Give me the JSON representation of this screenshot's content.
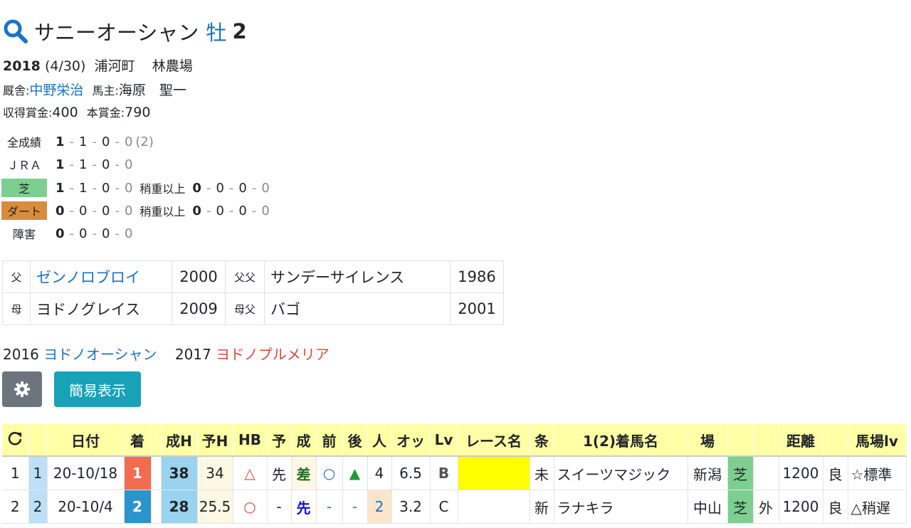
{
  "horse": {
    "name": "サニーオーシャン",
    "sex": "牡",
    "age": "2",
    "birth_year": "2018",
    "birth_date": "(4/30)",
    "location": "浦河町",
    "breeder": "林農場",
    "stable_label": "厩舎:",
    "trainer": "中野栄治",
    "owner_label": "馬主:",
    "owner": "海原　聖一",
    "earned_label": "収得賞金:",
    "earned": "400",
    "prize_label": "本賞金:",
    "prize": "790"
  },
  "records": {
    "all": {
      "label": "全成績",
      "v": [
        "1",
        "1",
        "0",
        "0"
      ],
      "extra": "(2)"
    },
    "jra": {
      "label": "ＪＲＡ",
      "v": [
        "1",
        "1",
        "0",
        "0"
      ]
    },
    "turf": {
      "label": "芝",
      "v": [
        "1",
        "1",
        "0",
        "0"
      ],
      "sub_label": "稍重以上",
      "sub": [
        "0",
        "0",
        "0",
        "0"
      ]
    },
    "dirt": {
      "label": "ダート",
      "v": [
        "0",
        "0",
        "0",
        "0"
      ],
      "sub_label": "稍重以上",
      "sub": [
        "0",
        "0",
        "0",
        "0"
      ]
    },
    "jump": {
      "label": "障害",
      "v": [
        "0",
        "0",
        "0",
        "0"
      ]
    }
  },
  "pedigree": {
    "sire_label": "父",
    "sire": "ゼンノロブロイ",
    "sire_year": "2000",
    "sire_sire_label": "父父",
    "sire_sire": "サンデーサイレンス",
    "sire_sire_year": "1986",
    "dam_label": "母",
    "dam": "ヨドノグレイス",
    "dam_year": "2009",
    "dam_sire_label": "母父",
    "dam_sire": "バゴ",
    "dam_sire_year": "2001"
  },
  "siblings": [
    {
      "year": "2016",
      "name": "ヨドノオーシャン"
    },
    {
      "year": "2017",
      "name": "ヨドノプルメリア"
    }
  ],
  "buttons": {
    "settings_icon": "gear-icon",
    "simple_view": "簡易表示"
  },
  "table": {
    "refresh_icon": "refresh-icon",
    "headers": [
      "",
      "",
      "日付",
      "着",
      "",
      "成H",
      "予H",
      "HB",
      "予",
      "成",
      "前",
      "後",
      "人",
      "オッ",
      "Lv",
      "レース名",
      "条",
      "1(2)着馬名",
      "場",
      "",
      "",
      "距離",
      "",
      "馬場lv"
    ],
    "rows": [
      {
        "no": "1",
        "idx": "1",
        "date": "20-10/18",
        "pos": "1",
        "seiH": "38",
        "yoH": "34",
        "hb": "△",
        "yo": "先",
        "sei": "差",
        "mae": "○",
        "ato": "▲",
        "pop": "4",
        "odds": "6.5",
        "lv": "B",
        "race": "",
        "cond": "未",
        "rival": "スイーツマジック",
        "course": "新潟",
        "surface": "芝",
        "inout": "",
        "dist": "1200",
        "going": "良",
        "track": "☆標準"
      },
      {
        "no": "2",
        "idx": "2",
        "date": "20-10/4",
        "pos": "2",
        "seiH": "28",
        "yoH": "25.5",
        "hb": "○",
        "yo": "-",
        "sei": "先",
        "mae": "-",
        "ato": "-",
        "pop": "2",
        "odds": "3.2",
        "lv": "C",
        "race": "",
        "cond": "新",
        "rival": "ラナキラ",
        "course": "中山",
        "surface": "芝",
        "inout": "外",
        "dist": "1200",
        "going": "良",
        "track": "△稍遅"
      }
    ]
  },
  "colors": {
    "link": "#1a73c7",
    "red_link": "#e0483e",
    "header_bg": "#ffffa6",
    "turf": "#7dcf8f",
    "dirt": "#d98c3d",
    "button_teal": "#17a2b8",
    "button_grey": "#6c757d"
  }
}
